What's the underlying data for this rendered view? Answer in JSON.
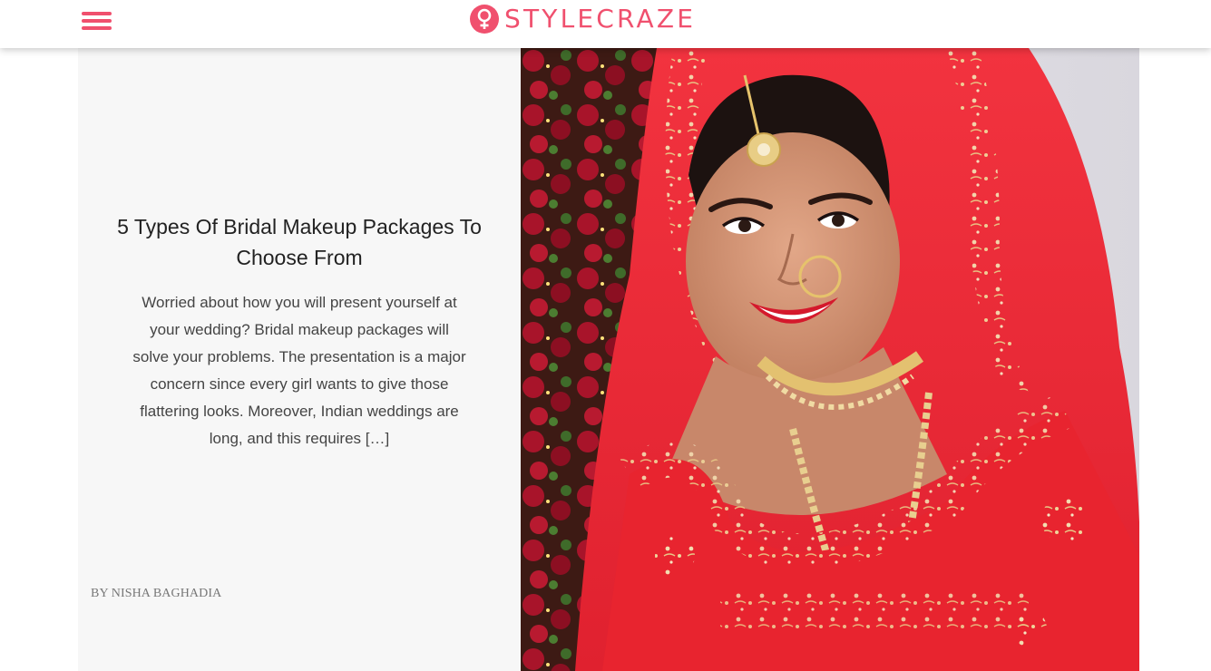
{
  "header": {
    "brand": "STYLECRAZE",
    "menu_icon": "hamburger-menu-icon",
    "logo_icon": "female-symbol-icon",
    "accent_color": "#f0506e"
  },
  "article": {
    "title": "5 Types Of Bridal Makeup Packages To Choose From",
    "excerpt": "Worried about how you will present yourself at your wedding? Bridal makeup packages will solve your problems. The presentation is a major concern since every girl wants to give those flattering looks. Moreover, Indian weddings are long, and this requires […]",
    "byline": "BY NISHA BAGHADIA"
  }
}
